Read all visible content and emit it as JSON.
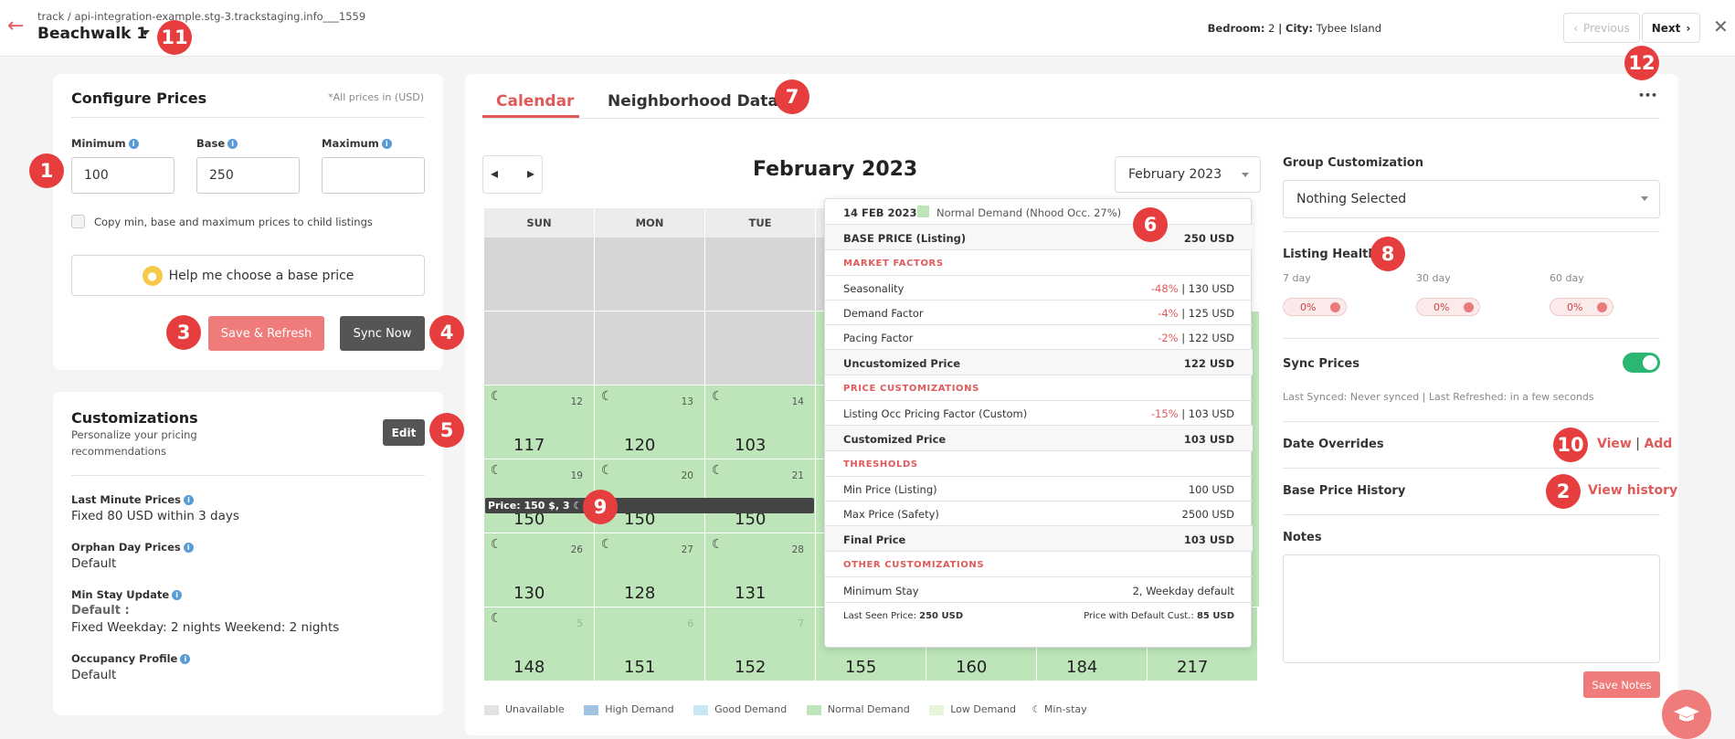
{
  "header": {
    "breadcrumb": "track / api-integration-example.stg-3.trackstaging.info___1559",
    "title": "Beachwalk 1",
    "bedroom_label": "Bedroom:",
    "bedroom_value": "2",
    "separator": "|",
    "city_label": "City:",
    "city_value": "Tybee Island",
    "prev_label": "Previous",
    "next_label": "Next"
  },
  "markers": [
    "1",
    "2",
    "3",
    "4",
    "5",
    "6",
    "7",
    "8",
    "9",
    "10",
    "11",
    "12"
  ],
  "configure": {
    "title": "Configure Prices",
    "note": "*All prices in (USD)",
    "min_label": "Minimum",
    "base_label": "Base",
    "max_label": "Maximum",
    "min_value": "100",
    "base_value": "250",
    "max_value": "",
    "copy_label": "Copy min, base and maximum prices to child listings",
    "help_label": "Help me choose a base price",
    "save_label": "Save & Refresh",
    "sync_label": "Sync Now"
  },
  "customizations": {
    "title": "Customizations",
    "subtitle_1": "Personalize your pricing",
    "subtitle_2": "recommendations",
    "edit_label": "Edit",
    "last_minute_label": "Last Minute Prices",
    "last_minute_value": "Fixed 80 USD within 3 days",
    "orphan_label": "Orphan Day Prices",
    "orphan_value": "Default",
    "min_stay_label": "Min Stay Update",
    "min_stay_default": "Default :",
    "min_stay_value": "Fixed Weekday: 2 nights Weekend: 2 nights",
    "occupancy_label": "Occupancy Profile",
    "occupancy_value": "Default"
  },
  "tabs": {
    "calendar": "Calendar",
    "neighborhood": "Neighborhood Data",
    "more": "•••"
  },
  "calendar": {
    "month_title": "February 2023",
    "month_select": "February 2023",
    "days": [
      "SUN",
      "MON",
      "TUE"
    ],
    "row3": [
      {
        "d": "12",
        "p": "117"
      },
      {
        "d": "13",
        "p": "120"
      },
      {
        "d": "14",
        "p": "103"
      }
    ],
    "row4": [
      {
        "d": "19",
        "p": "150"
      },
      {
        "d": "20",
        "p": "150"
      },
      {
        "d": "21",
        "p": "150"
      }
    ],
    "row5": [
      {
        "d": "26",
        "p": "130"
      },
      {
        "d": "27",
        "p": "128"
      },
      {
        "d": "28",
        "p": "131"
      }
    ],
    "row6": [
      {
        "d": "5",
        "p": "148"
      },
      {
        "d": "6",
        "p": "151"
      },
      {
        "d": "7",
        "p": "152"
      },
      {
        "p": "155"
      },
      {
        "p": "160"
      },
      {
        "p": "184"
      },
      {
        "p": "217"
      }
    ],
    "price_tooltip": "Price: 150 $, 3",
    "ms_icon": "moon-icon"
  },
  "tooltip": {
    "date": "14 FEB 2023",
    "demand": "Normal Demand (Nhood Occ. 27%)",
    "base_label": "BASE PRICE (Listing)",
    "base_value": "250 USD",
    "sec_market": "MARKET FACTORS",
    "seasonality_label": "Seasonality",
    "seasonality_pct": "-48%",
    "seasonality_val": "| 130 USD",
    "demand_label": "Demand Factor",
    "demand_pct": "-4%",
    "demand_val": "| 125 USD",
    "pacing_label": "Pacing Factor",
    "pacing_pct": "-2%",
    "pacing_val": "| 122 USD",
    "uncust_label": "Uncustomized Price",
    "uncust_value": "122 USD",
    "sec_price_cust": "PRICE CUSTOMIZATIONS",
    "occ_label": "Listing Occ Pricing Factor (Custom)",
    "occ_pct": "-15%",
    "occ_val": "| 103 USD",
    "cust_label": "Customized Price",
    "cust_value": "103 USD",
    "sec_thresholds": "THRESHOLDS",
    "min_label": "Min Price (Listing)",
    "min_value": "100 USD",
    "max_label": "Max Price (Safety)",
    "max_value": "2500 USD",
    "final_label": "Final Price",
    "final_value": "103 USD",
    "sec_other": "OTHER CUSTOMIZATIONS",
    "minstay_label": "Minimum Stay",
    "minstay_value": "2, Weekday default",
    "last_seen_label": "Last Seen Price:",
    "last_seen_value": "250 USD",
    "default_cust_label": "Price with Default Cust.:",
    "default_cust_value": "85 USD"
  },
  "legend": {
    "unavailable": "Unavailable",
    "high": "High Demand",
    "good": "Good Demand",
    "normal": "Normal Demand",
    "low": "Low Demand",
    "minstay": "Min-stay",
    "colors": {
      "unavailable": "#e3e3e3",
      "high": "#9fc3e0",
      "good": "#c9e6f7",
      "normal": "#bde5b9",
      "low": "#e6f5d8"
    }
  },
  "right": {
    "group_label": "Group Customization",
    "group_select": "Nothing Selected",
    "health_label": "Listing Health",
    "h7_label": "7 day",
    "h30_label": "30 day",
    "h60_label": "60 day",
    "h7": "0%",
    "h30": "0%",
    "h60": "0%",
    "sync_label": "Sync Prices",
    "sync_info": "Last Synced: Never synced | Last Refreshed: in a few seconds",
    "overrides_label": "Date Overrides",
    "view": "View",
    "sep": "|",
    "add": "Add",
    "history_label": "Base Price History",
    "view_history": "View history",
    "notes_label": "Notes",
    "save_notes": "Save Notes"
  },
  "colors": {
    "accent": "#e05a5a",
    "marker": "#e63e3e",
    "normal_demand": "#bde5b9",
    "toggle_on": "#2bb673"
  }
}
